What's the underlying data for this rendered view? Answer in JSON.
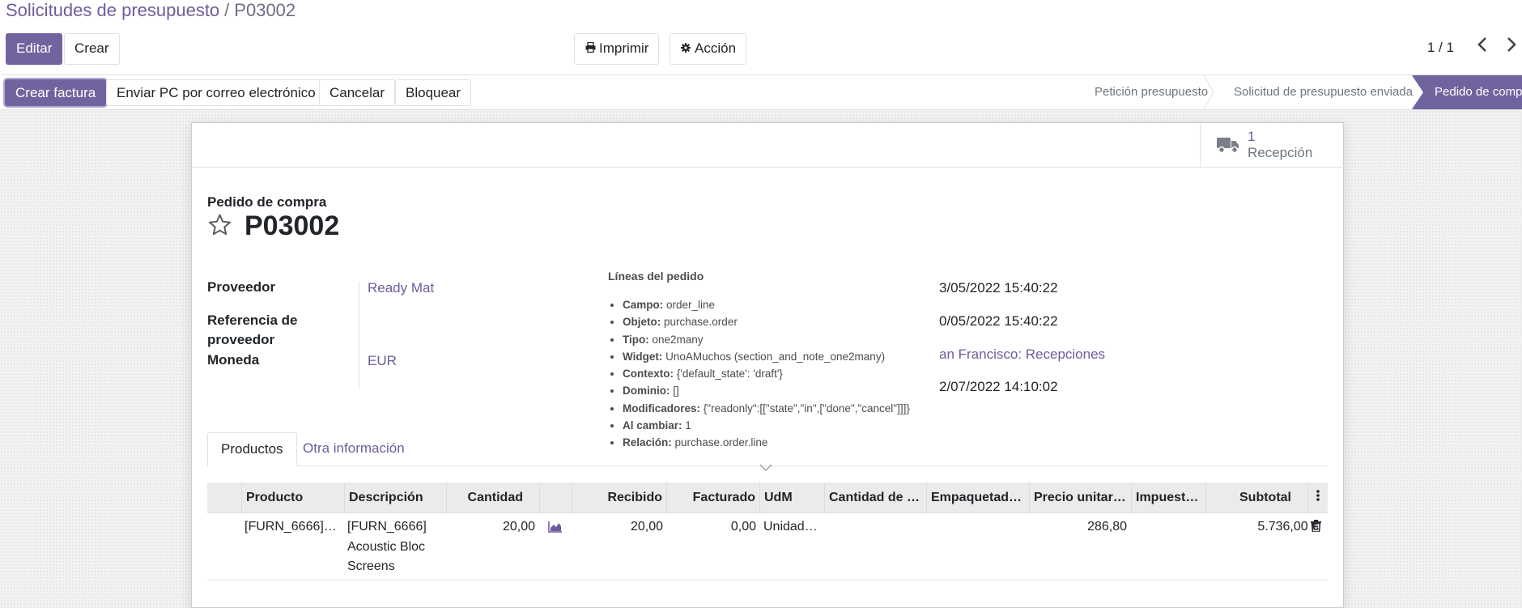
{
  "breadcrumb": {
    "parent": "Solicitudes de presupuesto",
    "separator": "/",
    "current": "P03002"
  },
  "toolbar": {
    "edit_label": "Editar",
    "create_label": "Crear",
    "print_label": "Imprimir",
    "action_label": "Acción",
    "print_icon": "print-icon",
    "action_icon": "gear-icon"
  },
  "pager": {
    "value": "1 / 1"
  },
  "header_buttons": {
    "create_invoice": "Crear factura",
    "send_email": "Enviar PC por correo electrónico",
    "cancel": "Cancelar",
    "lock": "Bloquear"
  },
  "statusbar": {
    "steps": [
      "Petición presupuesto",
      "Solicitud de presupuesto enviada"
    ],
    "active": "Pedido de compra"
  },
  "smart_button": {
    "count": "1",
    "label": "Recepción",
    "icon": "truck-icon"
  },
  "title": {
    "subtitle": "Pedido de compra",
    "name": "P03002"
  },
  "fields_left": {
    "vendor_label": "Proveedor",
    "vendor_value": "Ready Mat",
    "vendor_ref_label_1": "Referencia de",
    "vendor_ref_label_2": "proveedor",
    "currency_label": "Moneda",
    "currency_value": "EUR"
  },
  "fields_right": {
    "order_deadline": "3/05/2022 15:40:22",
    "confirmation_date": "0/05/2022 15:40:22",
    "deliver_to": "an Francisco: Recepciones",
    "receipt_date": "2/07/2022 14:10:02"
  },
  "tabs": {
    "products": "Productos",
    "other_info": "Otra información"
  },
  "table": {
    "headers": [
      "Producto",
      "Descripción",
      "Cantidad",
      "",
      "Recibido",
      "Facturado",
      "UdM",
      "Cantidad de …",
      "Empaquetad…",
      "Precio unitar…",
      "Impuest…",
      "Subtotal"
    ],
    "row": {
      "product": "[FURN_6666]…",
      "description_1": "[FURN_6666]",
      "description_2": "Acoustic Bloc",
      "description_3": "Screens",
      "quantity": "20,00",
      "received": "20,00",
      "invoiced": "0,00",
      "uom": "Unidad…",
      "unit_price": "286,80",
      "subtotal": "5.736,00 €"
    }
  },
  "tooltip": {
    "title": "Líneas del pedido",
    "items": [
      {
        "key": "Campo:",
        "value": "order_line"
      },
      {
        "key": "Objeto:",
        "value": "purchase.order"
      },
      {
        "key": "Tipo:",
        "value": "one2many"
      },
      {
        "key": "Widget:",
        "value": "UnoAMuchos (section_and_note_one2many)"
      },
      {
        "key": "Contexto:",
        "value": "{'default_state': 'draft'}"
      },
      {
        "key": "Dominio:",
        "value": "[]"
      },
      {
        "key": "Modificadores:",
        "value": "{\"readonly\":[[\"state\",\"in\",[\"done\",\"cancel\"]]]}"
      },
      {
        "key": "Al cambiar:",
        "value": "1"
      },
      {
        "key": "Relación:",
        "value": "purchase.order.line"
      }
    ]
  },
  "colors": {
    "primary": "#71639e",
    "link": "#6f5b9c"
  }
}
